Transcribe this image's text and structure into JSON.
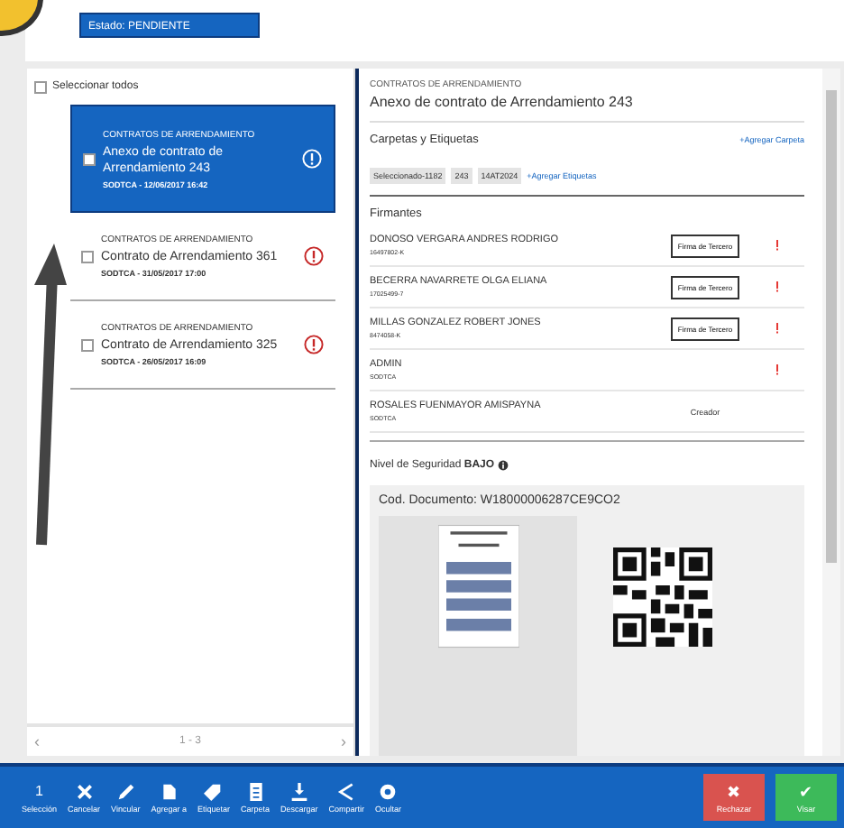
{
  "status_field": {
    "value": "Estado: PENDIENTE"
  },
  "list": {
    "select_all": {
      "label": "Seleccionar todos",
      "checked": false
    },
    "items": [
      {
        "category": "CONTRATOS DE ARRENDAMIENTO",
        "title": "Anexo de contrato de Arrendamiento 243",
        "meta": "SODTCA - 12/06/2017 16:42",
        "selected": true,
        "checked": false
      },
      {
        "category": "CONTRATOS DE ARRENDAMIENTO",
        "title": "Contrato de Arrendamiento 361",
        "meta": "SODTCA - 31/05/2017 17:00",
        "selected": false,
        "checked": false
      },
      {
        "category": "CONTRATOS DE ARRENDAMIENTO",
        "title": "Contrato de Arrendamiento 325",
        "meta": "SODTCA - 26/05/2017 16:09",
        "selected": false,
        "checked": false
      }
    ],
    "pagination": {
      "prev": "‹",
      "range": "1 - 3",
      "next": "›"
    }
  },
  "detail": {
    "category": "CONTRATOS DE ARRENDAMIENTO",
    "title": "Anexo de contrato de Arrendamiento 243",
    "folders_heading": "Carpetas y Etiquetas",
    "add_folder": "+Agregar Carpeta",
    "tags": [
      "Seleccionado-1182",
      "243",
      "14AT2024"
    ],
    "add_tags": "+Agregar Etiquetas",
    "signers_heading": "Firmantes",
    "signers": [
      {
        "kind": "signature",
        "name": "DONOSO VERGARA ANDRES RODRIGO",
        "id": "16497802-K",
        "action": "Firma de Tercero",
        "alert": true
      },
      {
        "kind": "signature",
        "name": "BECERRA NAVARRETE OLGA ELIANA",
        "id": "17025499-7",
        "action": "Firma de Tercero",
        "alert": true
      },
      {
        "kind": "signature",
        "name": "MILLAS GONZALEZ ROBERT JONES",
        "id": "8474058-K",
        "action": "Firma de Tercero",
        "alert": true
      },
      {
        "kind": "plain",
        "name": "ADMIN",
        "id": "SODTCA",
        "alert": true
      },
      {
        "kind": "creator",
        "name": "ROSALES FUENMAYOR AMISPAYNA",
        "id": "SODTCA",
        "role": "Creador",
        "alert": false
      }
    ],
    "security": "Nivel de Seguridad **BAJO**",
    "document_code": "Cod. Documento: W18000006287CE9CO2"
  },
  "toolbar": {
    "actions": [
      {
        "kind": "count",
        "count": "1",
        "label": "Selección"
      },
      {
        "kind": "cancel",
        "label": "Cancelar"
      },
      {
        "kind": "link",
        "label": "Vincular"
      },
      {
        "kind": "folder",
        "label": "Agregar a"
      },
      {
        "kind": "tag",
        "label": "Etiquetar"
      },
      {
        "kind": "document",
        "label": "Carpeta"
      },
      {
        "kind": "download",
        "label": "Descargar"
      },
      {
        "kind": "share",
        "label": "Compartir"
      },
      {
        "kind": "hide",
        "label": "Ocultar"
      }
    ],
    "reject": {
      "icon": "✖",
      "label": "Rechazar"
    },
    "approve": {
      "icon": "✔",
      "label": "Visar"
    }
  }
}
